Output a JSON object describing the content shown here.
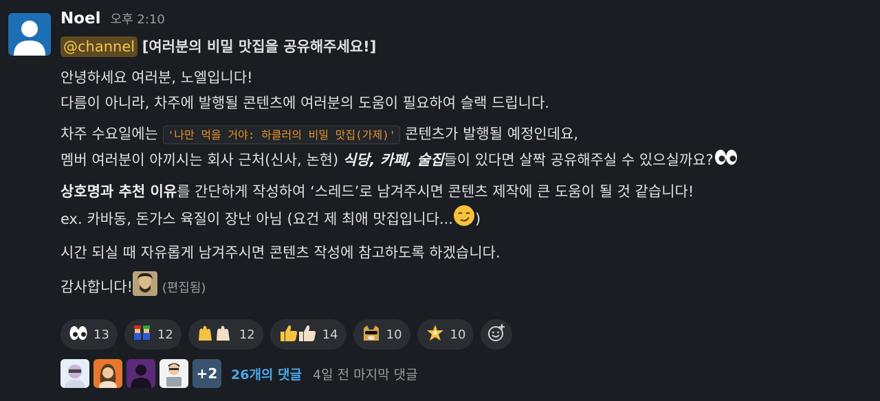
{
  "message": {
    "author": "Noel",
    "time": "오후 2:10",
    "mention": "@channel",
    "title": "[여러분의 비밀 맛집을 공유해주세요!]",
    "p1_line1": "안녕하세요 여러분, 노엘입니다!",
    "p1_line2": "다름이 아니라, 차주에 발행될 콘텐츠에 여러분의 도움이 필요하여 슬랙 드립니다.",
    "p2_line1_a": "차주 수요일에는",
    "p2_code": "'나만 먹을 거야: 하클러의 비밀 맛집(가제)'",
    "p2_line1_b": "콘텐츠가 발행될 예정인데요,",
    "p2_line2_a": "멤버 여러분이 아끼시는 회사 근처(신사, 논현)",
    "p2_line2_bold": "식당, 카페, 술집",
    "p2_line2_b": "들이 있다면 살짝 공유해주실 수 있으실까요?",
    "p3_bold": "상호명과 추천 이유",
    "p3_line1": "를 간단하게 작성하여 ‘스레드’로 남겨주시면 콘텐츠 제작에 큰 도움이 될 것 같습니다!",
    "p3_line2": "ex. 카바동, 돈가스 육질이 장난 아님 (요건 제 최애 맛집입니다...",
    "p3_line2_end": ")",
    "p4": "시간 되실 때 자유롭게 남겨주시면 콘텐츠 작성에 참고하도록 하겠습니다.",
    "p5": "감사합니다!",
    "edited": "(편집됨)"
  },
  "reactions": [
    {
      "icon": "eyes-emoji",
      "count": "13"
    },
    {
      "icon": "mario-luigi-emoji",
      "count": "12"
    },
    {
      "icon": "raised-hands-emoji",
      "count": "12"
    },
    {
      "icon": "thumbs-up-emoji",
      "count": "14"
    },
    {
      "icon": "doge-sunglasses-emoji",
      "count": "10"
    },
    {
      "icon": "star-emoji",
      "count": "10"
    }
  ],
  "thread": {
    "more_count": "+2",
    "replies": "26개의 댓글",
    "last_reply": "4일 전 마지막 댓글"
  }
}
